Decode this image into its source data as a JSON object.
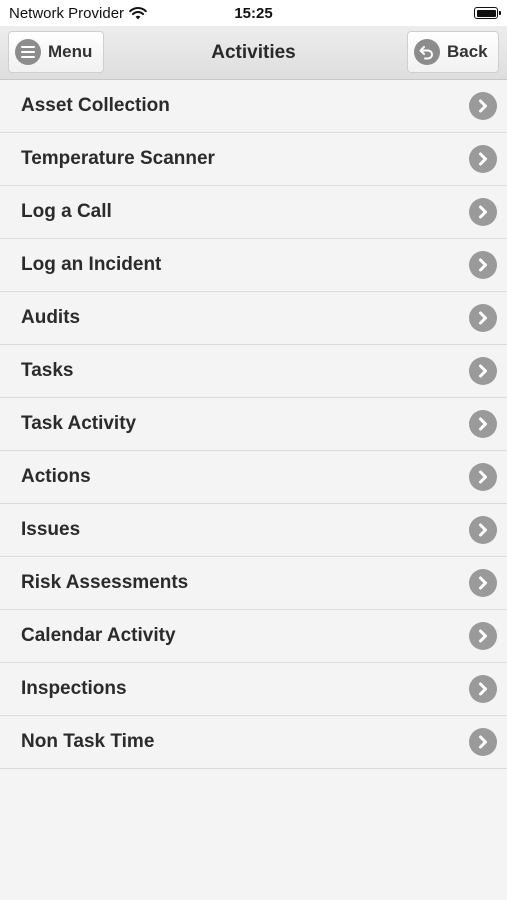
{
  "status_bar": {
    "carrier": "Network Provider",
    "time": "15:25",
    "icons": [
      "wifi-icon",
      "battery-icon"
    ]
  },
  "nav": {
    "title": "Activities",
    "menu_label": "Menu",
    "back_label": "Back",
    "icons": {
      "menu": "hamburger-icon",
      "back": "back-arrow-icon"
    }
  },
  "list": {
    "item_icon": "chevron-right-icon",
    "items": [
      {
        "label": "Asset Collection"
      },
      {
        "label": "Temperature Scanner"
      },
      {
        "label": "Log a Call"
      },
      {
        "label": "Log an Incident"
      },
      {
        "label": "Audits"
      },
      {
        "label": "Tasks"
      },
      {
        "label": "Task Activity"
      },
      {
        "label": "Actions"
      },
      {
        "label": "Issues"
      },
      {
        "label": "Risk Assessments"
      },
      {
        "label": "Calendar Activity"
      },
      {
        "label": "Inspections"
      },
      {
        "label": "Non Task Time"
      }
    ]
  },
  "colors": {
    "background": "#f4f4f4",
    "icon_gray": "#9a9a9a",
    "text": "#2b2b2b"
  }
}
